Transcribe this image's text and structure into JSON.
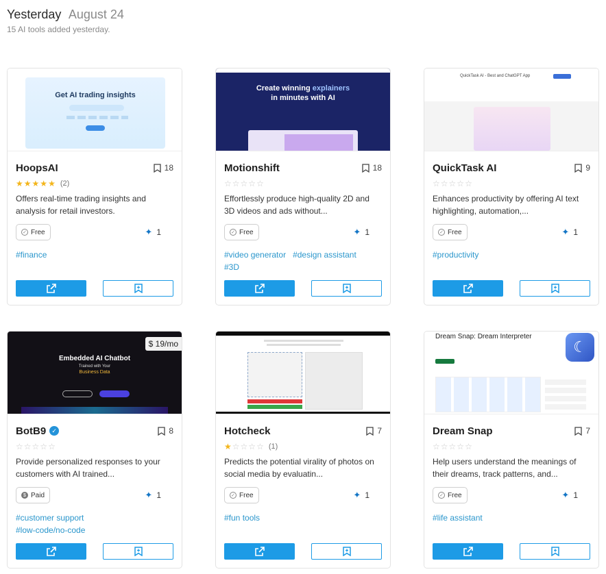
{
  "header": {
    "day": "Yesterday",
    "date": "August 24",
    "subtitle": "15 AI tools added yesterday."
  },
  "thumb_text": {
    "hoops_headline": "Get AI trading insights",
    "motion_line1": "Create winning",
    "motion_accent": "explainers",
    "motion_line2": "in minutes with AI",
    "quicktask_title": "QuickTask AI - Best and ChatGPT App",
    "botb9_headline": "Embedded AI Chatbot",
    "botb9_sub": "Trained with Your",
    "botb9_accent": "Business Data",
    "dream_title": "Dream Snap: Dream Interpreter",
    "dream_icon": "☾"
  },
  "colors": {
    "accent": "#1d9be6",
    "tag": "#2a96cc",
    "star_on": "#f3b51b",
    "star_off": "#c8c8c8"
  },
  "cards": [
    {
      "name": "HoopsAI",
      "saves": "18",
      "rating": 5,
      "reviews": "(2)",
      "description": "Offers real-time trading insights and analysis for retail investors.",
      "pricing": "Free",
      "upvotes": "1",
      "tags": [
        "#finance"
      ]
    },
    {
      "name": "Motionshift",
      "saves": "18",
      "rating": 0,
      "reviews": "",
      "description": "Effortlessly produce high-quality 2D and 3D videos and ads without...",
      "pricing": "Free",
      "upvotes": "1",
      "tags": [
        "#video generator",
        "#design assistant",
        "#3D"
      ]
    },
    {
      "name": "QuickTask AI",
      "saves": "9",
      "rating": 0,
      "reviews": "",
      "description": "Enhances productivity by offering AI text highlighting, automation,...",
      "pricing": "Free",
      "upvotes": "1",
      "tags": [
        "#productivity"
      ]
    },
    {
      "name": "BotB9",
      "saves": "8",
      "rating": 0,
      "reviews": "",
      "description": "Provide personalized responses to your customers with AI trained...",
      "pricing": "Paid",
      "upvotes": "1",
      "tags": [
        "#customer support",
        "#low-code/no-code"
      ],
      "price_tag": "$ 19/mo",
      "verified": true
    },
    {
      "name": "Hotcheck",
      "saves": "7",
      "rating": 1,
      "reviews": "(1)",
      "description": "Predicts the potential virality of photos on social media by evaluatin...",
      "pricing": "Free",
      "upvotes": "1",
      "tags": [
        "#fun tools"
      ]
    },
    {
      "name": "Dream Snap",
      "saves": "7",
      "rating": 0,
      "reviews": "",
      "description": "Help users understand the meanings of their dreams, track patterns, and...",
      "pricing": "Free",
      "upvotes": "1",
      "tags": [
        "#life assistant"
      ]
    }
  ]
}
